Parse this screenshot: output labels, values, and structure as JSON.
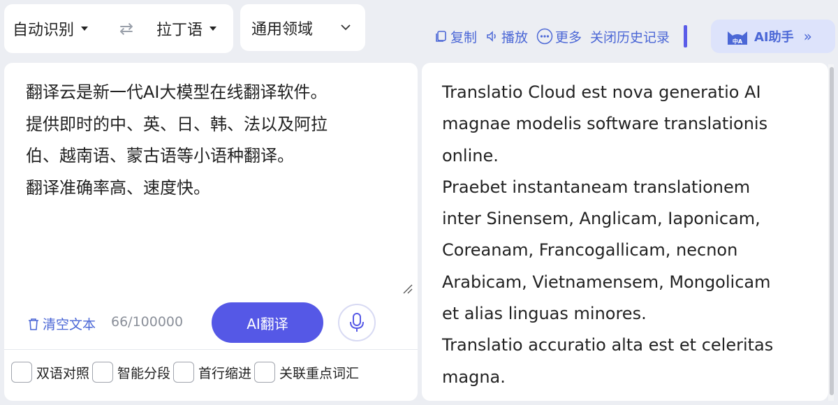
{
  "language_bar": {
    "source_lang": "自动识别",
    "swap_icon": "swap-arrows-icon",
    "target_lang": "拉丁语"
  },
  "domain_select": {
    "value": "通用领域",
    "icon": "chevron-down-icon"
  },
  "toolbar": {
    "copy_label": "复制",
    "play_label": "播放",
    "more_label": "更多",
    "history_label": "关闭历史记录",
    "ai_helper_label": "AI助手",
    "ai_helper_badge": "中A"
  },
  "source": {
    "text": "翻译云是新一代AI大模型在线翻译软件。\n提供即时的中、英、日、韩、法以及阿拉\n伯、越南语、蒙古语等小语种翻译。\n翻译准确率高、速度快。",
    "clear_label": "清空文本",
    "char_count": "66/100000",
    "translate_button": "AI翻译",
    "options": [
      "双语对照",
      "智能分段",
      "首行缩进",
      "关联重点词汇"
    ]
  },
  "target": {
    "text": "Translatio Cloud est nova generatio AI\nmagnae modelis software translationis\nonline.\nPraebet instantaneam translationem\ninter Sinensem, Anglicam, Iaponicam,\nCoreanam, Francogallicam, necnon\nArabicam, Vietnamensem, Mongolicam\net alias linguas minores.\nTranslatio accuratio alta est et celeritas\nmagna."
  },
  "colors": {
    "accent": "#5558e6",
    "link": "#4b67d6",
    "background": "#eceef3"
  }
}
